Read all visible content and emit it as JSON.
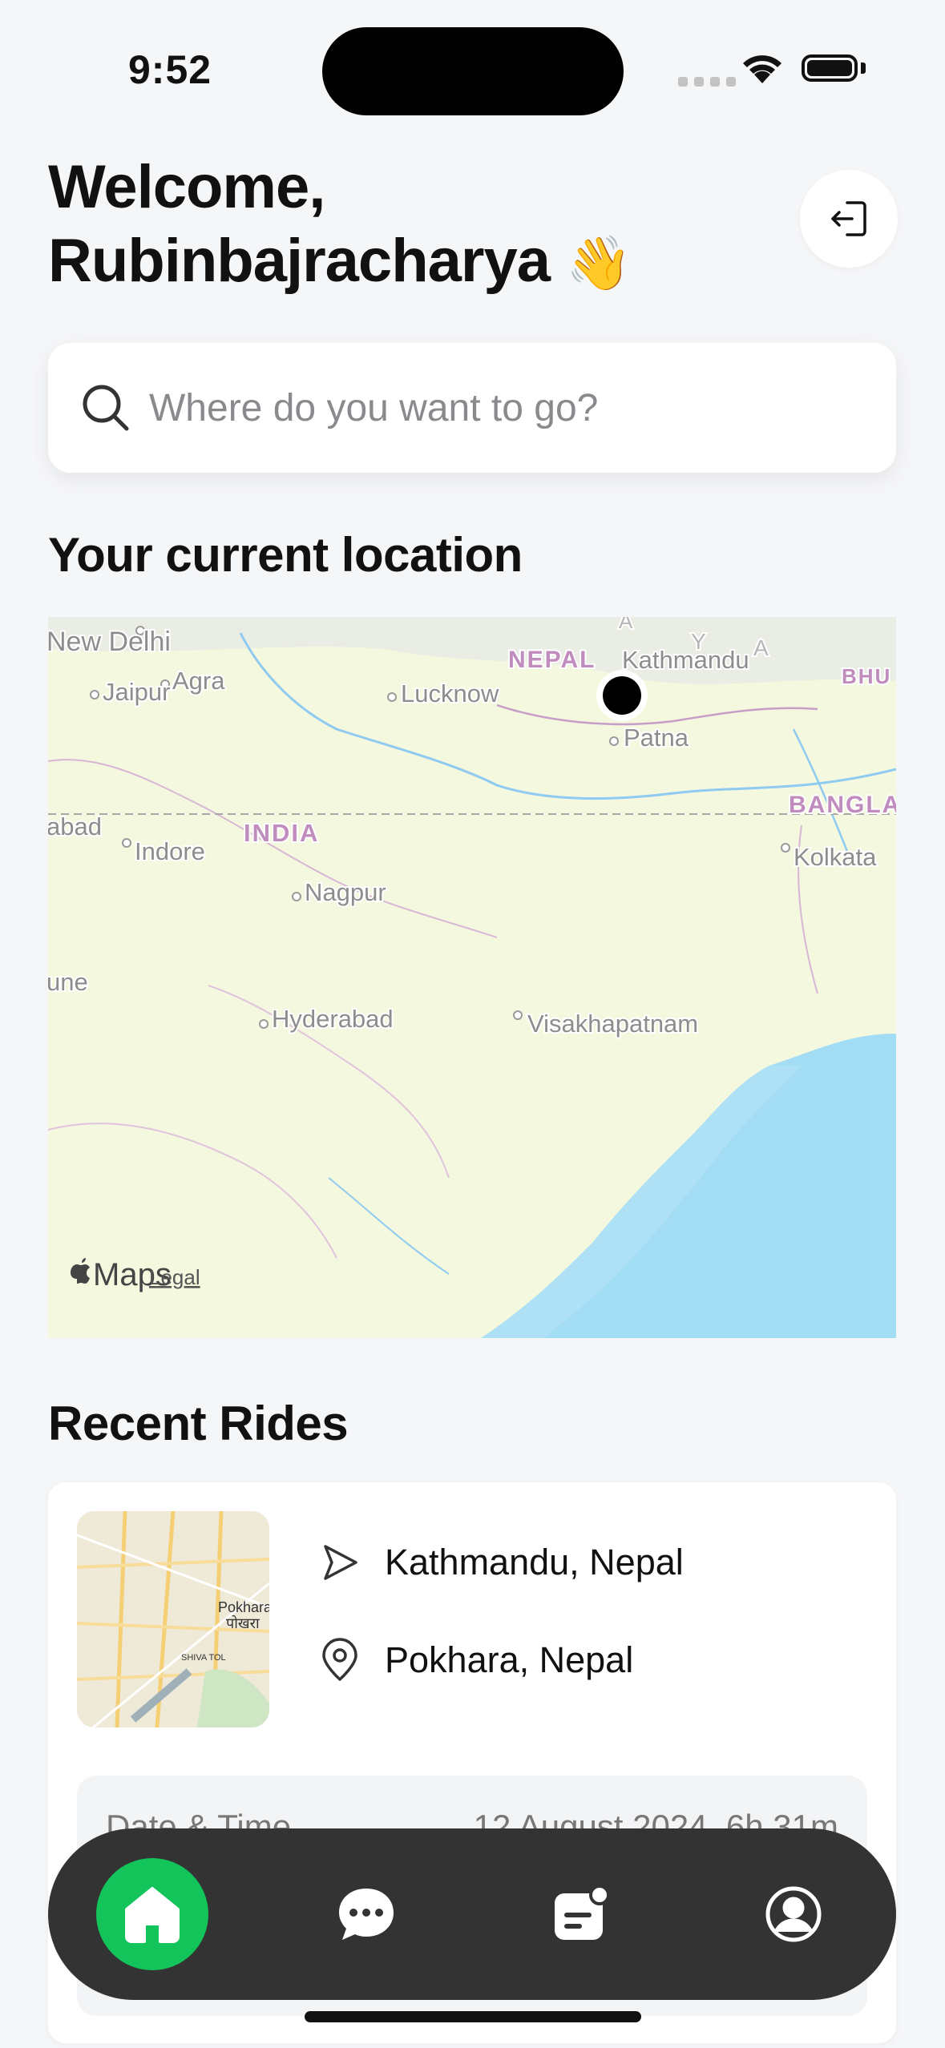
{
  "status_bar": {
    "time": "9:52"
  },
  "header": {
    "welcome_line1": "Welcome,",
    "welcome_name": "Rubinbajracharya",
    "wave_emoji": "👋",
    "logout_icon": "logout-icon"
  },
  "search": {
    "placeholder": "Where do you want to go?"
  },
  "current_location": {
    "title": "Your current location",
    "map": {
      "labels": [
        "New Delhi",
        "Jaipur",
        "Agra",
        "Lucknow",
        "NEPAL",
        "Kathmandu",
        "BHU",
        "Patna",
        "BANGLA",
        "abad",
        "INDIA",
        "Indore",
        "Kolkata",
        "Nagpur",
        "une",
        "Hyderabad",
        "Visakhapatnam",
        "Y",
        "A",
        "A"
      ],
      "attribution": "Maps",
      "legal": "Legal"
    }
  },
  "recent_rides": {
    "title": "Recent Rides",
    "rides": [
      {
        "from": "Kathmandu, Nepal",
        "to": "Pokhara, Nepal",
        "date_label": "Date & Time",
        "date_value": "12 August 2024, 6h 31m",
        "thumb_labels": [
          "Pokhara",
          "पोखरा",
          "SHIVA TOL"
        ]
      }
    ]
  },
  "tabbar": {
    "tabs": [
      {
        "name": "home",
        "icon": "home-icon",
        "active": true
      },
      {
        "name": "chat",
        "icon": "chat-icon",
        "active": false
      },
      {
        "name": "rides",
        "icon": "rides-icon",
        "active": false
      },
      {
        "name": "profile",
        "icon": "profile-icon",
        "active": false
      }
    ]
  },
  "colors": {
    "accent": "#13c45b",
    "tabbar": "#333333",
    "background": "#f5f6f8",
    "water": "#a3dcf5",
    "land": "#f4f8df"
  }
}
